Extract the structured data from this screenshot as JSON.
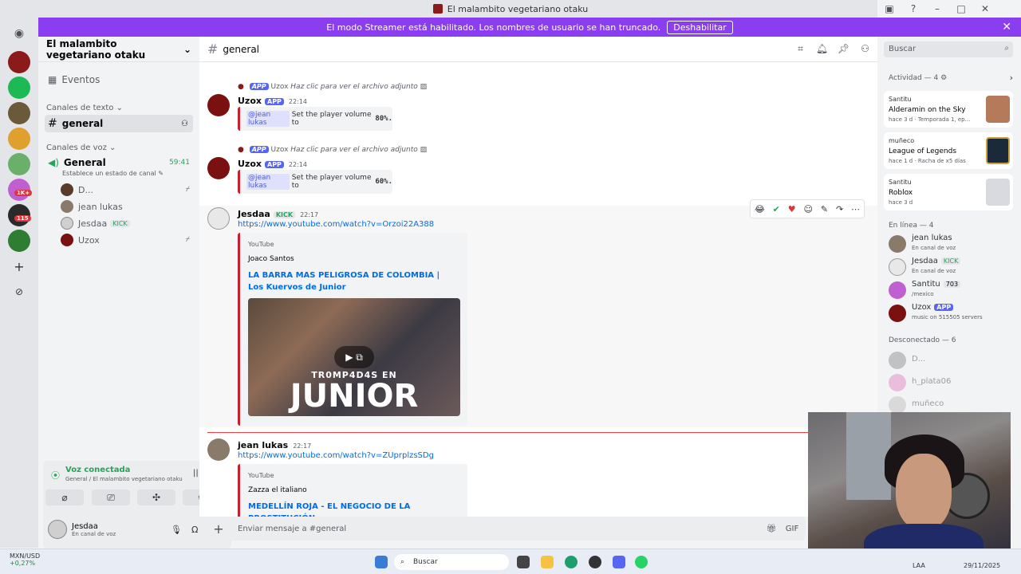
{
  "window": {
    "title": "El malambito vegetariano otaku"
  },
  "banner": {
    "text": "El modo Streamer está habilitado. Los nombres de usuario se han truncado.",
    "button": "Deshabilitar"
  },
  "rail": {
    "badges": [
      "1K+",
      "115"
    ]
  },
  "sidebar": {
    "server_name": "El malambito vegetariano otaku",
    "events": "Eventos",
    "text_category": "Canales de texto",
    "text_channel": "general",
    "voice_category": "Canales de voz",
    "voice_channel": "General",
    "voice_timer": "59:41",
    "voice_status": "Establece un estado de canal",
    "voice_users": [
      "D...",
      "jean lukas",
      "Jesdaa",
      "Uzox"
    ],
    "kick_tag": "KICK"
  },
  "voice_panel": {
    "title": "Voz conectada",
    "subtitle": "General / El malambito vegetariano otaku"
  },
  "user_panel": {
    "name": "Jesdaa",
    "status": "En canal de voz"
  },
  "header": {
    "channel": "general",
    "search_placeholder": "Buscar"
  },
  "messages": [
    {
      "reply_user": "Uzox",
      "reply_text": "Haz clic para ver el archivo adjunto",
      "user": "Uzox",
      "tag": "APP",
      "time": "22:14",
      "mention": "@jean lukas",
      "text": "Set the player volume to",
      "value": "80%."
    },
    {
      "reply_user": "Uzox",
      "reply_text": "Haz clic para ver el archivo adjunto",
      "user": "Uzox",
      "tag": "APP",
      "time": "22:14",
      "mention": "@jean lukas",
      "text": "Set the player volume to",
      "value": "60%."
    },
    {
      "user": "Jesdaa",
      "tag": "KICK",
      "time": "22:17",
      "link": "https://www.youtube.com/watch?v=Orzoi22A388",
      "provider": "YouTube",
      "author": "Joaco Santos",
      "title": "LA BARRA MAS PELIGROSA DE COLOMBIA | Los Kuervos de Junior",
      "thumb_line1": "TR0MP4D4S EN",
      "thumb_line2": "JUNIOR"
    },
    {
      "user": "jean lukas",
      "time": "22:17",
      "link": "https://www.youtube.com/watch?v=ZUprplzsSDg",
      "provider": "YouTube",
      "author": "Zazza el italiano",
      "title": "MEDELLÍN ROJA - EL NEGOCIO DE LA PROSTITUCIÓN"
    }
  ],
  "composer": {
    "placeholder": "Enviar mensaje a #general"
  },
  "right_panel": {
    "activity_title": "Actividad — 4",
    "activities": [
      {
        "user": "Santitu",
        "title": "Alderamin on the Sky",
        "meta": "hace 3 d · Temporada 1, ep..."
      },
      {
        "user": "muñeco",
        "title": "League of Legends",
        "meta": "hace 1 d · Racha de x5 días"
      },
      {
        "user": "Santitu",
        "title": "Roblox",
        "meta": "hace 3 d"
      }
    ],
    "online_title": "En línea — 4",
    "online": [
      {
        "name": "jean lukas",
        "sub": "En canal de voz"
      },
      {
        "name": "Jesdaa",
        "tag": "KICK",
        "sub": "En canal de voz"
      },
      {
        "name": "Santitu",
        "tag": "703",
        "sub": "/mexico"
      },
      {
        "name": "Uzox",
        "tag": "APP",
        "sub": "music on 515505 servers"
      }
    ],
    "offline_title": "Desconectado — 6",
    "offline": [
      "D...",
      "h_plata06",
      "muñeco"
    ]
  },
  "taskbar": {
    "search": "Buscar",
    "stock_name": "MXN/USD",
    "stock_change": "+0,27%",
    "lang": "LAA",
    "date": "29/11/2025"
  },
  "colors": {
    "accent": "#5865f2",
    "banner": "#8b3df0",
    "embed_border": "#c8202e",
    "link": "#006ce7",
    "voice_green": "#23a55a"
  }
}
